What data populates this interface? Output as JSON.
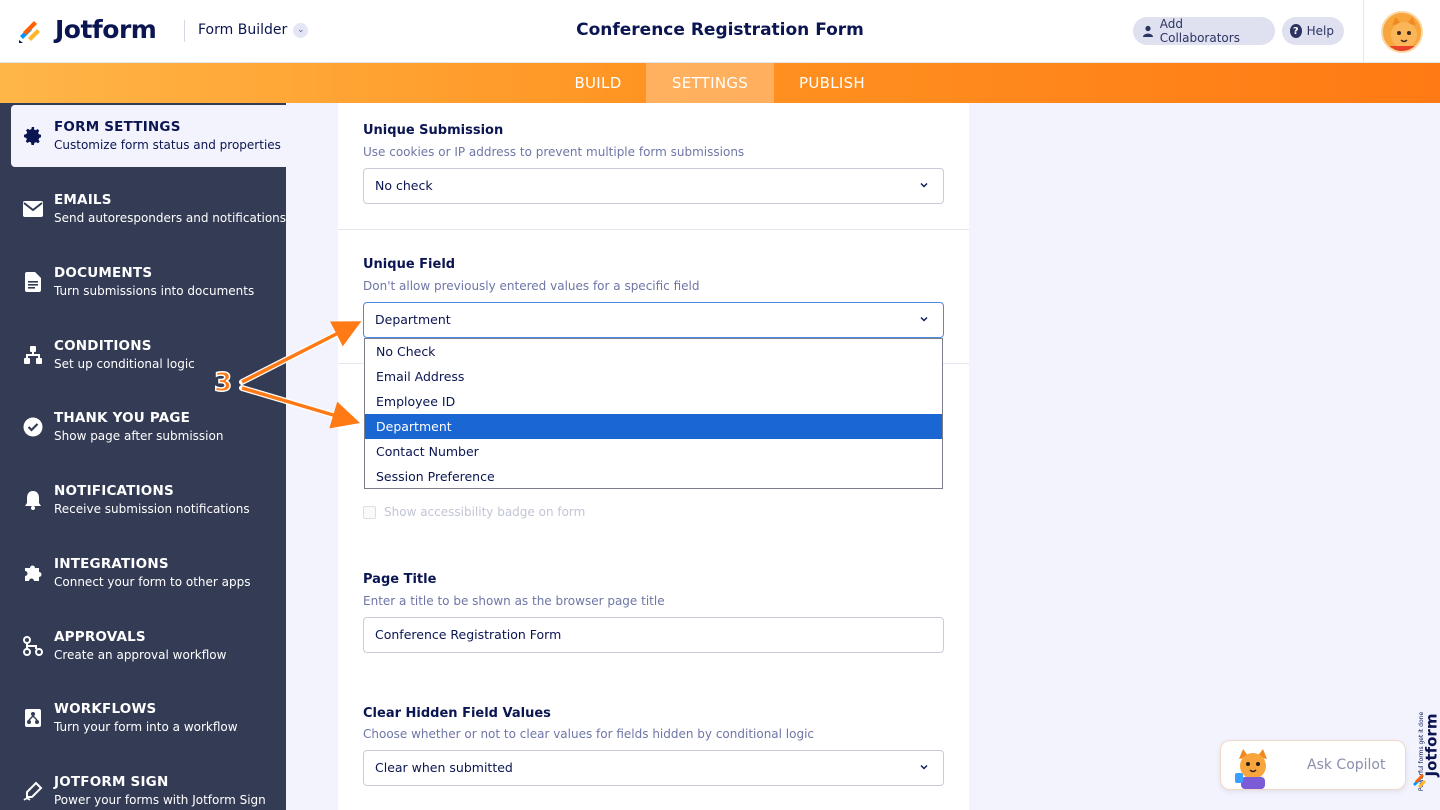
{
  "header": {
    "brand": "Jotform",
    "form_builder_label": "Form Builder",
    "page_title": "Conference Registration Form",
    "add_collaborators_label": "Add Collaborators",
    "help_label": "Help"
  },
  "tabs": {
    "build": "BUILD",
    "settings": "SETTINGS",
    "publish": "PUBLISH"
  },
  "sidebar": {
    "items": [
      {
        "title": "FORM SETTINGS",
        "desc": "Customize form status and properties"
      },
      {
        "title": "EMAILS",
        "desc": "Send autoresponders and notifications"
      },
      {
        "title": "DOCUMENTS",
        "desc": "Turn submissions into documents"
      },
      {
        "title": "CONDITIONS",
        "desc": "Set up conditional logic"
      },
      {
        "title": "THANK YOU PAGE",
        "desc": "Show page after submission"
      },
      {
        "title": "NOTIFICATIONS",
        "desc": "Receive submission notifications"
      },
      {
        "title": "INTEGRATIONS",
        "desc": "Connect your form to other apps"
      },
      {
        "title": "APPROVALS",
        "desc": "Create an approval workflow"
      },
      {
        "title": "WORKFLOWS",
        "desc": "Turn your form into a workflow"
      },
      {
        "title": "JOTFORM SIGN",
        "desc": "Power your forms with Jotform Sign"
      }
    ]
  },
  "settings": {
    "unique_submission": {
      "label": "Unique Submission",
      "desc": "Use cookies or IP address to prevent multiple form submissions",
      "value": "No check"
    },
    "unique_field": {
      "label": "Unique Field",
      "desc": "Don't allow previously entered values for a specific field",
      "value": "Department",
      "options": [
        "No Check",
        "Email Address",
        "Employee ID",
        "Department",
        "Contact Number",
        "Session Preference"
      ]
    },
    "accessibility_badge": {
      "label": "Show accessibility badge on form"
    },
    "page_title": {
      "label": "Page Title",
      "desc": "Enter a title to be shown as the browser page title",
      "value": "Conference Registration Form"
    },
    "clear_hidden": {
      "label": "Clear Hidden Field Values",
      "desc": "Choose whether or not to clear values for fields hidden by conditional logic",
      "value": "Clear when submitted"
    }
  },
  "annotation": {
    "step_number": "3"
  },
  "copilot": {
    "label": "Ask Copilot"
  },
  "side_brand": {
    "name": "Jotform",
    "tagline": "Powerful forms get it done"
  },
  "colors": {
    "accent_orange": "#ff7a14",
    "sidebar_bg": "#343c55",
    "selected_option": "#1a66d2",
    "text_navy": "#0a1551"
  }
}
